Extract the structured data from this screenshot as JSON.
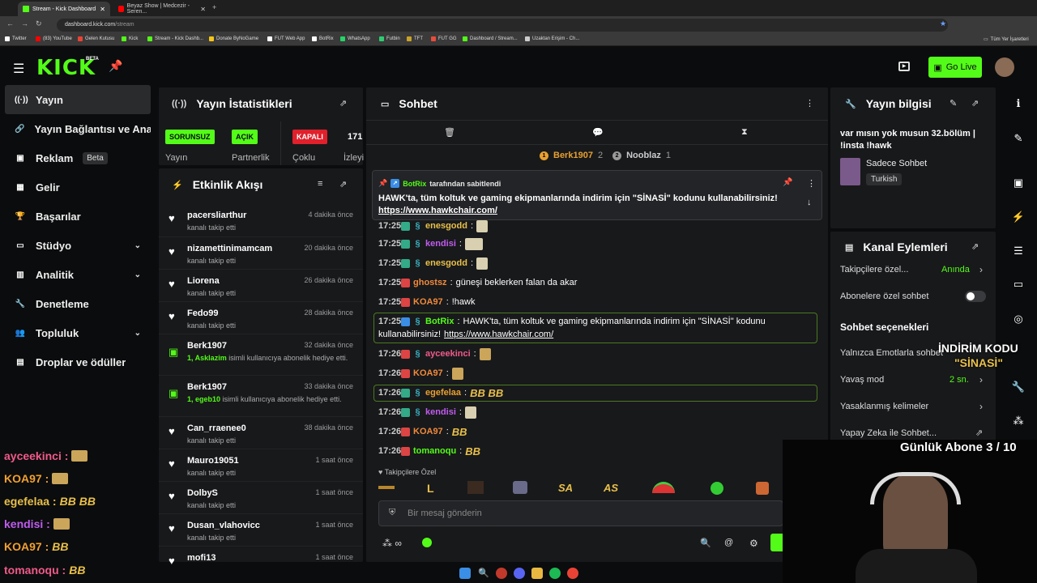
{
  "browser": {
    "tabs": [
      {
        "label": "Stream - Kick Dashboard",
        "active": true
      },
      {
        "label": "Beyaz Show | Medcezir - Seren..."
      }
    ],
    "url_host": "dashboard.kick.com",
    "url_path": "/stream",
    "bookmarks": [
      {
        "label": "Twitter",
        "color": "#ffffff"
      },
      {
        "label": "(83) YouTube",
        "color": "#ff0000"
      },
      {
        "label": "Gelen Kutusu",
        "color": "#ea4335"
      },
      {
        "label": "Kick",
        "color": "#53fc18"
      },
      {
        "label": "Stream - Kick Dashb...",
        "color": "#53fc18"
      },
      {
        "label": "Donate ByNoGame",
        "color": "#f5c518"
      },
      {
        "label": "FUT Web App",
        "color": "#ffffff"
      },
      {
        "label": "BotRix",
        "color": "#ffffff"
      },
      {
        "label": "WhatsApp",
        "color": "#25d366"
      },
      {
        "label": "Futbin",
        "color": "#2ecc71"
      },
      {
        "label": "TFT",
        "color": "#c9a227"
      },
      {
        "label": "FUT GG",
        "color": "#e74c3c"
      },
      {
        "label": "Dashboard / Stream...",
        "color": "#53fc18"
      },
      {
        "label": "Uzaktan Erişim - Ch...",
        "color": "#cccccc"
      }
    ],
    "all_bookmarks": "Tüm Yer İşaretleri"
  },
  "header": {
    "logo": "KICK",
    "logo_badge": "BETA",
    "go_live": "Go Live"
  },
  "sidebar": {
    "items": [
      {
        "label": "Yayın",
        "icon": "broadcast-icon",
        "glyph": "((·))",
        "active": true
      },
      {
        "label": "Yayın Bağlantısı ve Anahtarı",
        "icon": "link-icon",
        "glyph": "🔗"
      },
      {
        "label": "Reklam",
        "icon": "ad-icon",
        "glyph": "▣",
        "badge": "Beta"
      },
      {
        "label": "Gelir",
        "icon": "revenue-icon",
        "glyph": "▦"
      },
      {
        "label": "Başarılar",
        "icon": "trophy-icon",
        "glyph": "🏆"
      },
      {
        "label": "Stüdyo",
        "icon": "studio-icon",
        "glyph": "▭",
        "chevron": true
      },
      {
        "label": "Analitik",
        "icon": "analytics-icon",
        "glyph": "▥",
        "chevron": true
      },
      {
        "label": "Denetleme",
        "icon": "wrench-icon",
        "glyph": "🔧"
      },
      {
        "label": "Topluluk",
        "icon": "community-icon",
        "glyph": "👥",
        "chevron": true
      },
      {
        "label": "Droplar ve ödüller",
        "icon": "drops-icon",
        "glyph": "▤"
      }
    ]
  },
  "stats": {
    "title": "Yayın İstatistikleri",
    "items": [
      {
        "badge": "SORUNSUZ",
        "label": "Yayın",
        "color": "#53fc18"
      },
      {
        "badge": "AÇIK",
        "label": "Partnerlik",
        "color": "#53fc18"
      },
      {
        "badge": "KAPALI",
        "label": "Çoklu",
        "color": "#e0202b"
      },
      {
        "badge": "171",
        "label": "İzleyi"
      }
    ]
  },
  "activity": {
    "title": "Etkinlik Akışı",
    "items": [
      {
        "name": "pacersliarthur",
        "time": "4 dakika önce",
        "text": "kanalı takip etti",
        "type": "follow"
      },
      {
        "name": "nizamettinimamcam",
        "time": "20 dakika önce",
        "text": "kanalı takip etti",
        "type": "follow"
      },
      {
        "name": "Liorena",
        "time": "26 dakika önce",
        "text": "kanalı takip etti",
        "type": "follow"
      },
      {
        "name": "Fedo99",
        "time": "28 dakika önce",
        "text": "kanalı takip etti",
        "type": "follow"
      },
      {
        "name": "Berk1907",
        "time": "32 dakika önce",
        "highlight": "1, Asklazim",
        "text": "isimli kullanıcıya abonelik hediye etti.",
        "type": "gift"
      },
      {
        "name": "Berk1907",
        "time": "33 dakika önce",
        "highlight": "1, egeb10",
        "text": "isimli kullanıcıya abonelik hediye etti.",
        "type": "gift"
      },
      {
        "name": "Can_rraenee0",
        "time": "38 dakika önce",
        "text": "kanalı takip etti",
        "type": "follow"
      },
      {
        "name": "Mauro19051",
        "time": "1 saat önce",
        "text": "kanalı takip etti",
        "type": "follow"
      },
      {
        "name": "DolbyS",
        "time": "1 saat önce",
        "text": "kanalı takip etti",
        "type": "follow"
      },
      {
        "name": "Dusan_vlahovicc",
        "time": "1 saat önce",
        "text": "kanalı takip etti",
        "type": "follow"
      },
      {
        "name": "mofi13",
        "time": "1 saat önce",
        "text": "",
        "type": "follow"
      }
    ]
  },
  "chat": {
    "title": "Sohbet",
    "leaders": [
      {
        "rank": "1",
        "name": "Berk1907",
        "count": "2"
      },
      {
        "rank": "2",
        "name": "Nooblaz",
        "count": "1"
      }
    ],
    "pinned": {
      "by": "BotRix",
      "by_suffix": "tarafından sabitlendi",
      "text": "HAWK'ta, tüm koltuk ve gaming ekipmanlarında indirim için \"SİNASİ\" kodunu kullanabilirsiniz!",
      "link": "https://www.hawkchair.com/"
    },
    "messages": [
      {
        "time": "17:25",
        "user": "enesgodd",
        "color": "#e8c04a",
        "text": ""
      },
      {
        "time": "17:25",
        "user": "kendisi",
        "color": "#c05cf0",
        "text": ""
      },
      {
        "time": "17:25",
        "user": "enesgodd",
        "color": "#e8c04a",
        "text": ""
      },
      {
        "time": "17:25",
        "user": "ghostsz",
        "color": "#f08a3c",
        "text": "güneşi beklerken falan da akar"
      },
      {
        "time": "17:25",
        "user": "KOA97",
        "color": "#f08a3c",
        "text": "!hawk"
      },
      {
        "time": "17:25",
        "user": "BotRix",
        "color": "#53fc18",
        "text": "HAWK'ta, tüm koltuk ve gaming ekipmanlarında indirim için \"SİNASİ\" kodunu",
        "text2": "kullanabilirsiniz!",
        "link": "https://www.hawkchair.com/"
      },
      {
        "time": "17:26",
        "user": "ayceekinci",
        "color": "#f05a8a",
        "text": ""
      },
      {
        "time": "17:26",
        "user": "KOA97",
        "color": "#f08a3c",
        "text": ""
      },
      {
        "time": "17:26",
        "user": "egefelaa",
        "color": "#e8a030",
        "text": "BB BB"
      },
      {
        "time": "17:26",
        "user": "kendisi",
        "color": "#c05cf0",
        "text": ""
      },
      {
        "time": "17:26",
        "user": "KOA97",
        "color": "#f08a3c",
        "text": "BB"
      },
      {
        "time": "17:26",
        "user": "tomanoqu",
        "color": "#53fc18",
        "text": "BB"
      }
    ],
    "followers_only": "Takipçilere Özel",
    "emotes": [
      "SA",
      "AS"
    ],
    "input_placeholder": "Bir mesaj gönderin"
  },
  "stream_info": {
    "title": "Yayın bilgisi",
    "stream_title": "var mısın yok musun 32.bölüm | !insta !hawk",
    "category": "Sadece Sohbet",
    "language": "Turkish"
  },
  "channel_actions": {
    "title": "Kanal Eylemleri",
    "followers_only_label": "Takipçilere özel...",
    "followers_only_value": "Anında",
    "subs_only_label": "Abonelere özel sohbet",
    "section": "Sohbet seçenekleri",
    "emote_only": "Yalnızca Emotlarla sohbet",
    "slow_mode": "Yavaş mod",
    "slow_mode_value": "2 sn.",
    "banned_words": "Yasaklanmış kelimeler",
    "ai_chat": "Yapay Zeka ile Sohbet..."
  },
  "overlay": {
    "discount_line1": "İNDİRİM KODU",
    "discount_line2": "\"SİNASİ\"",
    "daily_subs": "Günlük Abone 3 / 10",
    "chat": [
      {
        "user": "ayceekinci :",
        "color": "#f05a8a"
      },
      {
        "user": "KOA97 :",
        "color": "#f0a030"
      },
      {
        "user": "egefelaa :",
        "color": "#e8c04a",
        "text": "BB BB"
      },
      {
        "user": "kendisi :",
        "color": "#c05cf0"
      },
      {
        "user": "KOA97 :",
        "color": "#f0a030",
        "text": "BB"
      },
      {
        "user": "tomanoqu :",
        "color": "#f05a8a",
        "text": "BB"
      }
    ]
  },
  "colors": {
    "accent": "#53fc18",
    "panel": "#18191b",
    "bg": "#0b0c0d"
  }
}
